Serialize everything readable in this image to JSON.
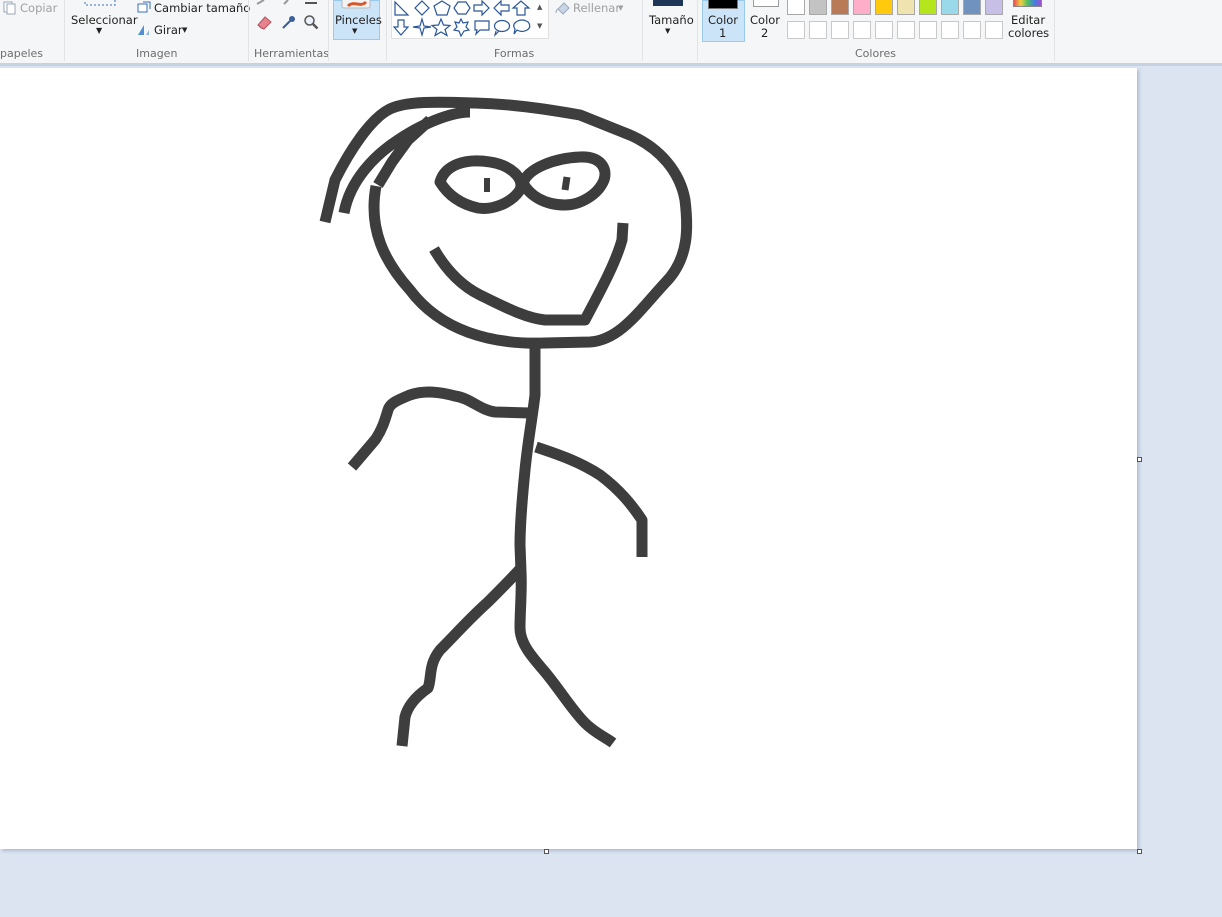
{
  "ribbon": {
    "clipboard": {
      "copy_label": "Copiar",
      "group_label": "papeles"
    },
    "image": {
      "select_label": "Seleccionar",
      "resize_label": "Cambiar tamaño",
      "rotate_label": "Girar",
      "group_label": "Imagen"
    },
    "tools": {
      "group_label": "Herramientas"
    },
    "brushes": {
      "label": "Pinceles"
    },
    "shapes": {
      "fill_label": "Rellenar",
      "group_label": "Formas"
    },
    "size": {
      "label": "Tamaño"
    },
    "colors": {
      "color1_label": "Color",
      "color1_num": "1",
      "color2_label": "Color",
      "color2_num": "2",
      "edit_label_1": "Editar",
      "edit_label_2": "colores",
      "group_label": "Colores",
      "color1_value": "#000000",
      "color2_value": "#ffffff",
      "palette_row1": [
        "#ffffff",
        "#c3c3c3",
        "#b97a57",
        "#ffaec9",
        "#ffc90e",
        "#efe4b0",
        "#b5e61d",
        "#99d9ea",
        "#7092be",
        "#c8bfe7"
      ]
    }
  },
  "canvas": {
    "background": "#ffffff",
    "stroke_color": "#3a3a3a"
  }
}
